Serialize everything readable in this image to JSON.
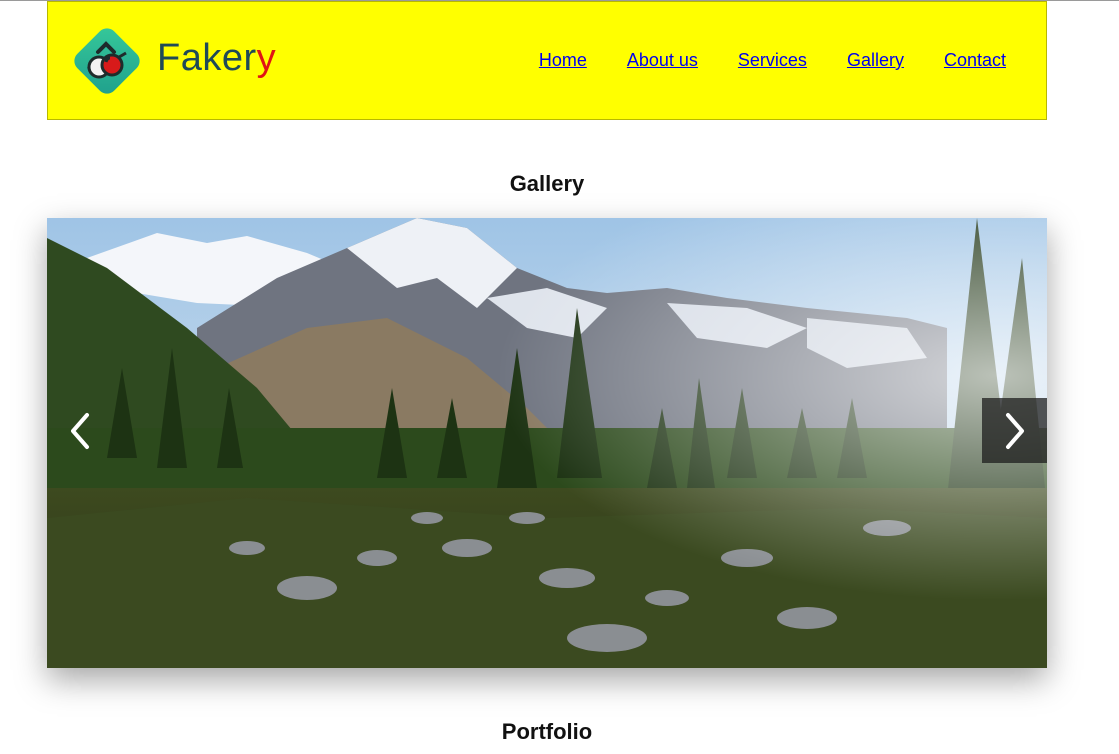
{
  "header": {
    "logo": {
      "text_main": "Faker",
      "text_accent": "y",
      "icon": "glasses-logo-icon"
    },
    "nav": [
      {
        "label": "Home"
      },
      {
        "label": "About us"
      },
      {
        "label": "Services"
      },
      {
        "label": "Gallery"
      },
      {
        "label": "Contact"
      }
    ]
  },
  "gallery": {
    "title": "Gallery",
    "slide": {
      "image": "mountain-landscape-image",
      "prev_icon": "chevron-left-icon",
      "next_icon": "chevron-right-icon"
    }
  },
  "portfolio": {
    "title": "Portfolio"
  },
  "colors": {
    "header_bg": "#ffff00",
    "logo_text": "#1f4a57",
    "logo_accent": "#e01414",
    "nav_link": "#0000ee"
  }
}
